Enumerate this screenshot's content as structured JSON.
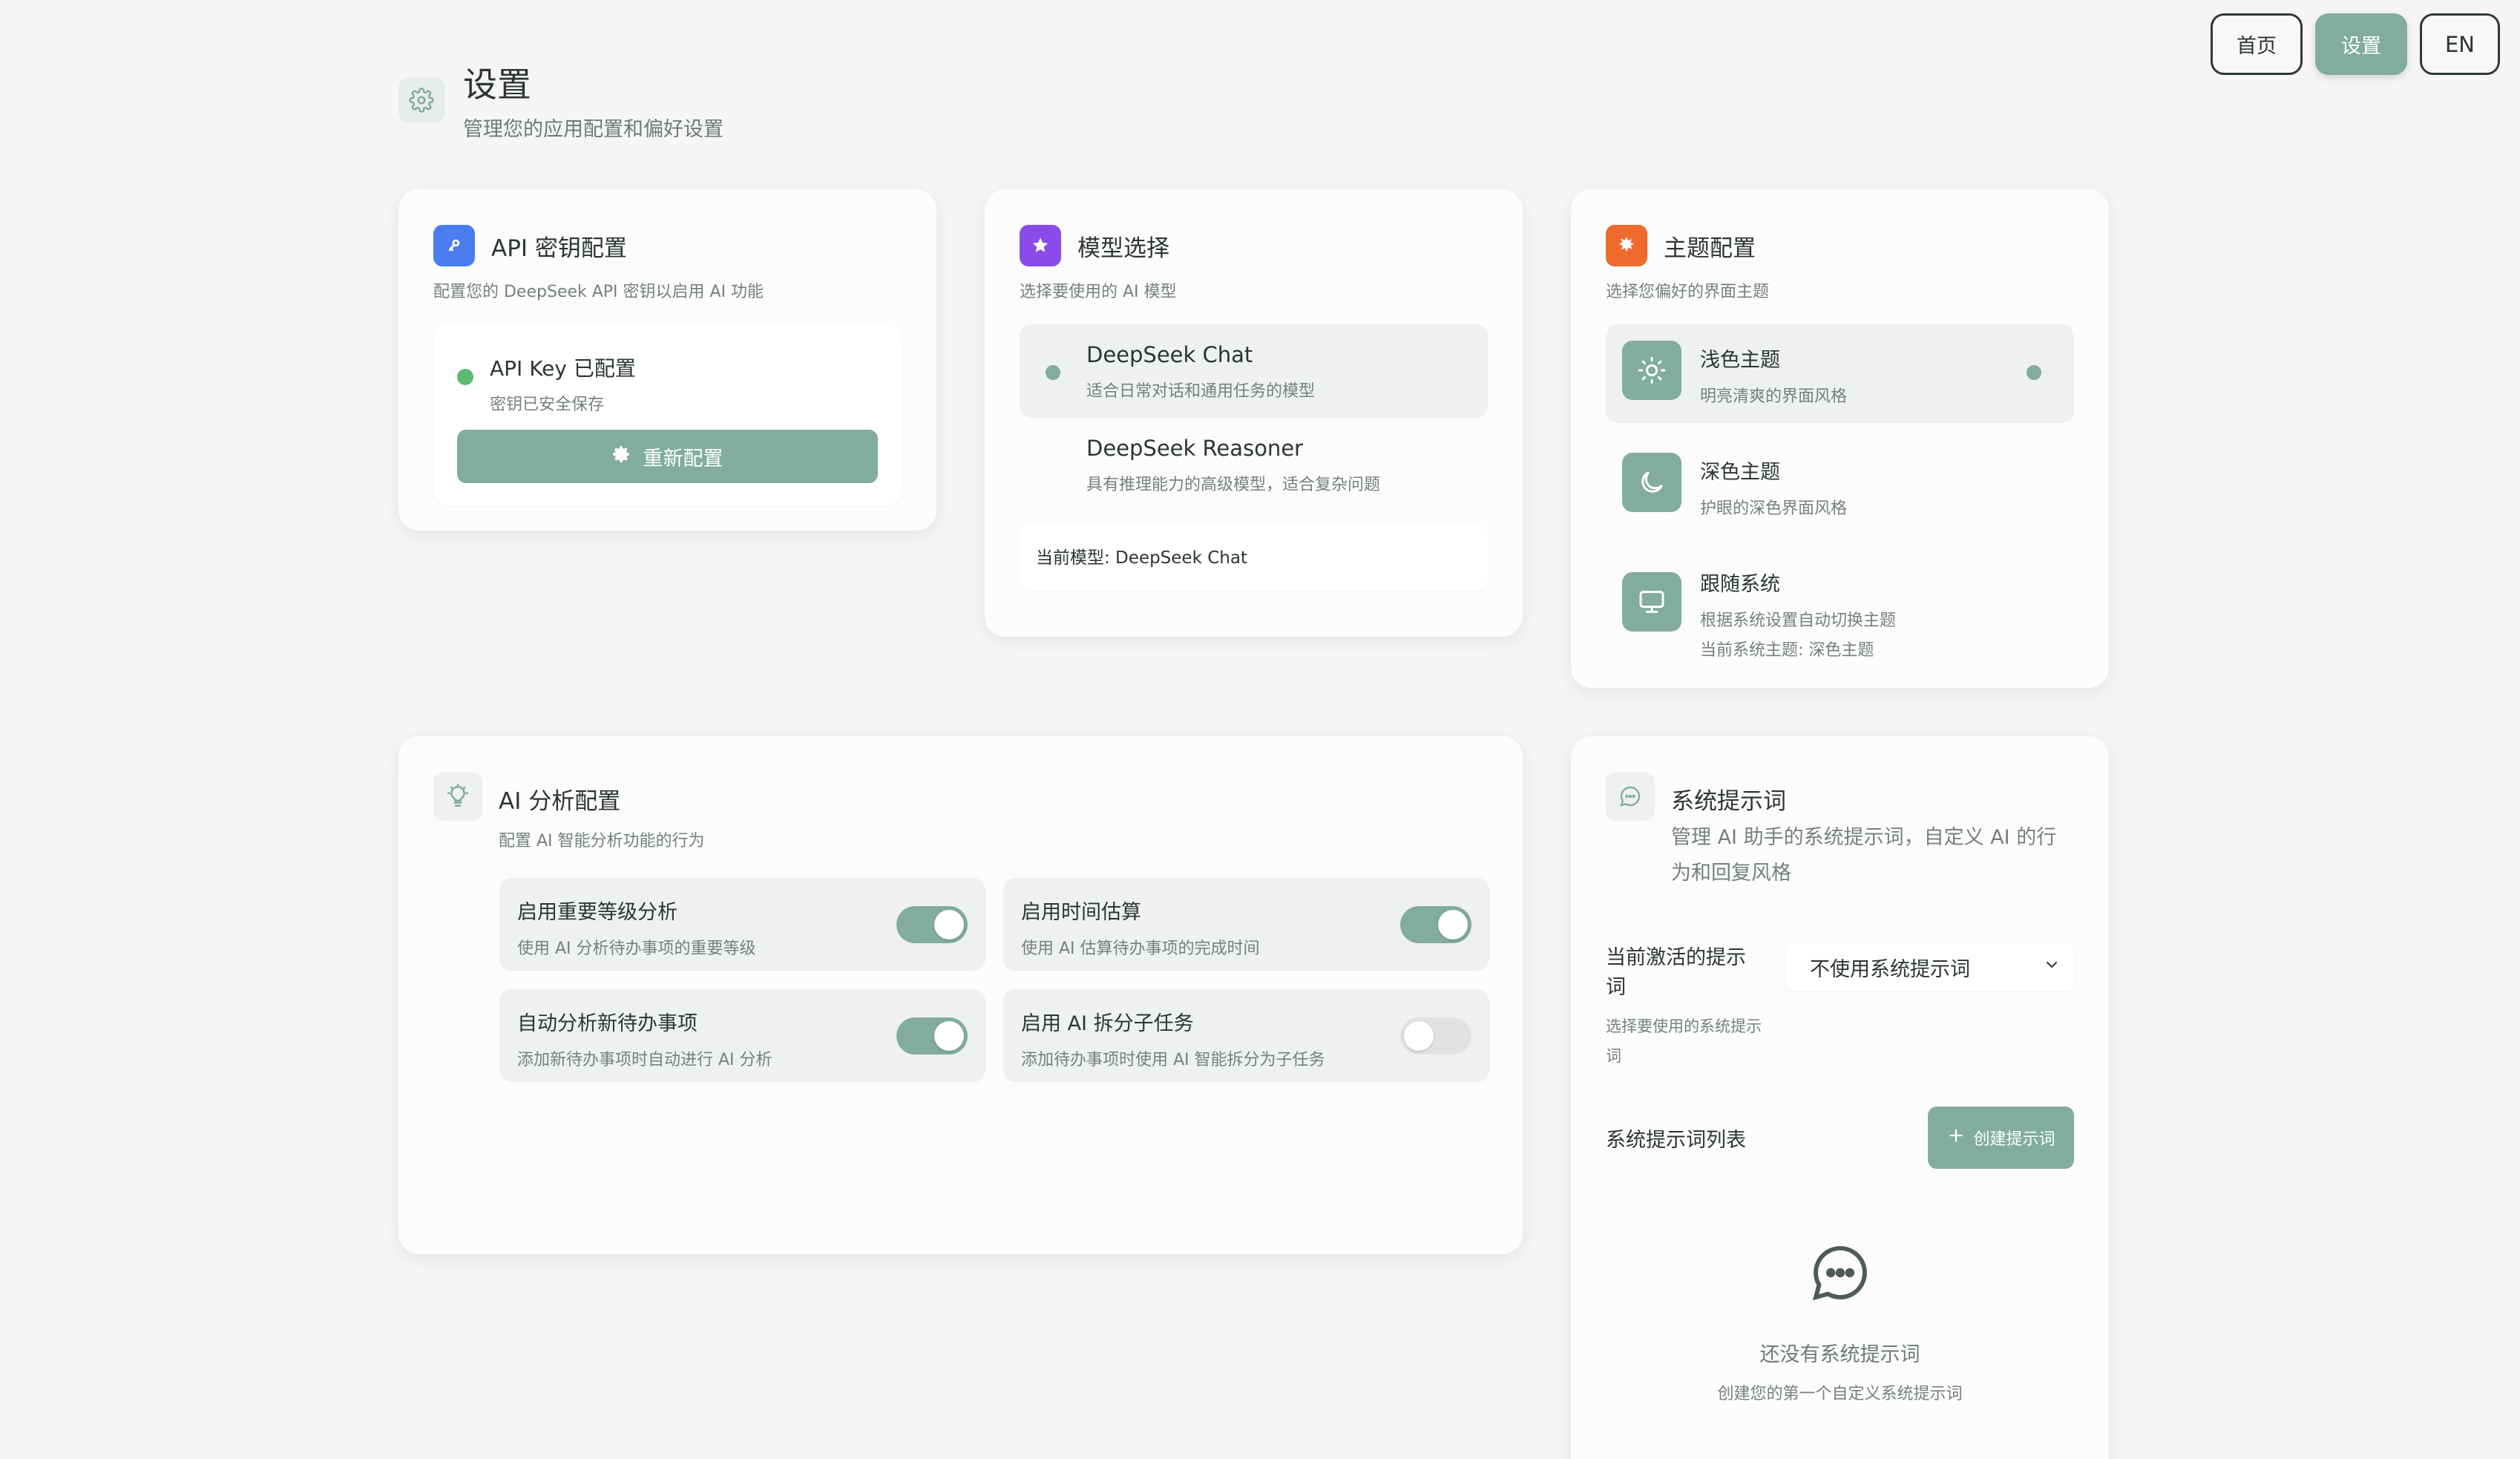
{
  "nav": {
    "home": "首页",
    "settings": "设置",
    "lang": "EN"
  },
  "page": {
    "title": "设置",
    "subtitle": "管理您的应用配置和偏好设置"
  },
  "api_card": {
    "title": "API 密钥配置",
    "subtitle": "配置您的 DeepSeek API 密钥以启用 AI 功能",
    "status_label": "API Key 已配置",
    "status_note": "密钥已安全保存",
    "reconfig_label": "重新配置"
  },
  "model_card": {
    "title": "模型选择",
    "subtitle": "选择要使用的 AI 模型",
    "options": [
      {
        "name": "DeepSeek Chat",
        "desc": "适合日常对话和通用任务的模型"
      },
      {
        "name": "DeepSeek Reasoner",
        "desc": "具有推理能力的高级模型，适合复杂问题"
      }
    ],
    "current": "当前模型: DeepSeek Chat"
  },
  "theme_card": {
    "title": "主题配置",
    "subtitle": "选择您偏好的界面主题",
    "options": [
      {
        "name": "浅色主题",
        "desc": "明亮清爽的界面风格"
      },
      {
        "name": "深色主题",
        "desc": "护眼的深色界面风格"
      },
      {
        "name": "跟随系统",
        "desc": "根据系统设置自动切换主题",
        "desc2": "当前系统主题: 深色主题"
      }
    ]
  },
  "ai_card": {
    "title": "AI 分析配置",
    "subtitle": "配置 AI 智能分析功能的行为",
    "toggles": [
      {
        "title": "启用重要等级分析",
        "desc": "使用 AI 分析待办事项的重要等级",
        "on": true
      },
      {
        "title": "启用时间估算",
        "desc": "使用 AI 估算待办事项的完成时间",
        "on": true
      },
      {
        "title": "自动分析新待办事项",
        "desc": "添加新待办事项时自动进行 AI 分析",
        "on": true
      },
      {
        "title": "启用 AI 拆分子任务",
        "desc": "添加待办事项时使用 AI 智能拆分为子任务",
        "on": false
      }
    ]
  },
  "prompt_card": {
    "title": "系统提示词",
    "subtitle": "管理 AI 助手的系统提示词，自定义 AI 的行为和回复风格",
    "active_label": "当前激活的提示词",
    "active_help": "选择要使用的系统提示词",
    "select_value": "不使用系统提示词",
    "list_label": "系统提示词列表",
    "create_label": "创建提示词",
    "empty_title": "还没有系统提示词",
    "empty_sub": "创建您的第一个自定义系统提示词"
  },
  "colors": {
    "accent": "#82ad9e",
    "status_green": "#5dbb70",
    "api_icon": "#4a7df0",
    "model_icon": "#8a4be8",
    "theme_icon": "#ee6b2d"
  },
  "icons": [
    "gear-icon",
    "key-icon",
    "star-icon",
    "sun-icon",
    "moon-icon",
    "monitor-icon",
    "lightbulb-icon",
    "chat-icon",
    "plus-icon",
    "chevron-down-icon"
  ]
}
